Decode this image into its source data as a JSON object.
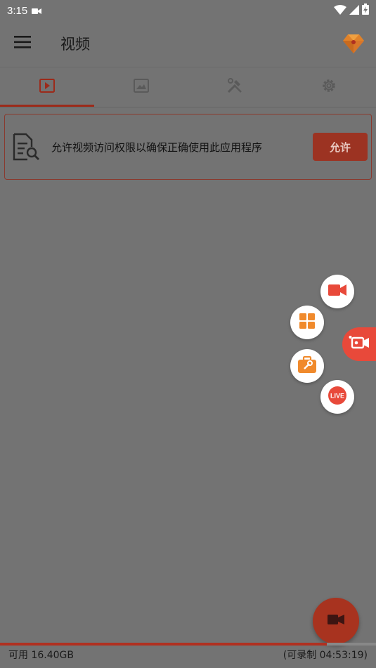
{
  "status_bar": {
    "time": "3:15",
    "icons": [
      "video-camera-icon",
      "wifi-icon",
      "signal-icon",
      "battery-icon"
    ]
  },
  "app_bar": {
    "title": "视频",
    "icons": [
      "menu-icon",
      "app-logo-icon"
    ]
  },
  "tabs": [
    {
      "name": "video",
      "icon": "play-icon",
      "selected": true
    },
    {
      "name": "image",
      "icon": "image-icon",
      "selected": false
    },
    {
      "name": "tools",
      "icon": "tools-icon",
      "selected": false
    },
    {
      "name": "settings",
      "icon": "gear-icon",
      "selected": false
    }
  ],
  "permission": {
    "message": "允许视频访问权限以确保正确使用此应用程序",
    "button_label": "允许"
  },
  "float_menu": {
    "items": [
      "record-video-icon",
      "grid-apps-icon",
      "toolbox-icon",
      "live-icon"
    ],
    "live_label": "LIVE",
    "side_icon": "screen-record-icon"
  },
  "storage": {
    "available": "可用 16.40GB",
    "recordable": "(可录制 04:53:19)",
    "used_fraction": 0.87
  },
  "colors": {
    "accent": "#a8331f",
    "float_red": "#e8493a",
    "orange": "#f08a2c"
  }
}
